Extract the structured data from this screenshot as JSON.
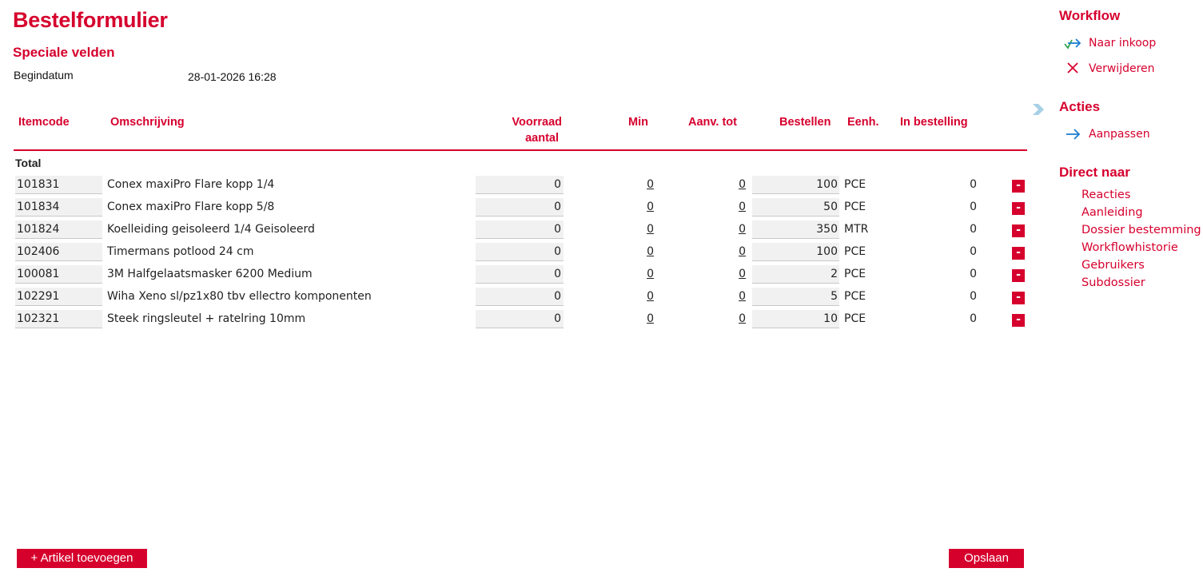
{
  "page": {
    "title": "Bestelformulier",
    "special_fields_title": "Speciale velden",
    "begindatum_label": "Begindatum",
    "begindatum_value": "28-01-2026 16:28",
    "total_label": "Total"
  },
  "table": {
    "columns": {
      "itemcode": "Itemcode",
      "omschrijving": "Omschrijving",
      "voorraad_line1": "Voorraad",
      "voorraad_line2": "aantal",
      "min": "Min",
      "aanv_tot": "Aanv. tot",
      "bestellen": "Bestellen",
      "eenh": "Eenh.",
      "in_bestelling": "In bestelling"
    },
    "rows": [
      {
        "code": "101831",
        "desc": "Conex maxiPro Flare kopp 1/4",
        "stock": "0",
        "min": "0",
        "aanv": "0",
        "order": "100",
        "unit": "PCE",
        "in_order": "0",
        "delete": "-"
      },
      {
        "code": "101834",
        "desc": "Conex maxiPro Flare kopp 5/8",
        "stock": "0",
        "min": "0",
        "aanv": "0",
        "order": "50",
        "unit": "PCE",
        "in_order": "0",
        "delete": "-"
      },
      {
        "code": "101824",
        "desc": "Koelleiding geisoleerd 1/4 Geisoleerd",
        "stock": "0",
        "min": "0",
        "aanv": "0",
        "order": "350",
        "unit": "MTR",
        "in_order": "0",
        "delete": "-"
      },
      {
        "code": "102406",
        "desc": "Timermans potlood 24 cm",
        "stock": "0",
        "min": "0",
        "aanv": "0",
        "order": "100",
        "unit": "PCE",
        "in_order": "0",
        "delete": "-"
      },
      {
        "code": "100081",
        "desc": "3M Halfgelaatsmasker 6200 Medium",
        "stock": "0",
        "min": "0",
        "aanv": "0",
        "order": "2",
        "unit": "PCE",
        "in_order": "0",
        "delete": "-"
      },
      {
        "code": "102291",
        "desc": "Wiha Xeno sl/pz1x80 tbv ellectro komponenten",
        "stock": "0",
        "min": "0",
        "aanv": "0",
        "order": "5",
        "unit": "PCE",
        "in_order": "0",
        "delete": "-"
      },
      {
        "code": "102321",
        "desc": "Steek ringsleutel + ratelring 10mm",
        "stock": "0",
        "min": "0",
        "aanv": "0",
        "order": "10",
        "unit": "PCE",
        "in_order": "0",
        "delete": "-"
      }
    ]
  },
  "buttons": {
    "add_article": "+ Artikel toevoegen",
    "save": "Opslaan"
  },
  "sidebar": {
    "workflow_title": "Workflow",
    "workflow_actions": [
      {
        "label": "Naar inkoop",
        "icon": "forward-arrow-check-icon"
      },
      {
        "label": "Verwijderen",
        "icon": "close-icon"
      }
    ],
    "actions_title": "Acties",
    "actions": [
      {
        "label": "Aanpassen",
        "icon": "arrow-right-icon"
      }
    ],
    "direct_title": "Direct naar",
    "direct_links": [
      "Reacties",
      "Aanleiding",
      "Dossier bestemming",
      "Workflowhistorie",
      "Gebruikers",
      "Subdossier"
    ]
  },
  "colors": {
    "accent": "#d6002d",
    "input_bg": "#f1f1f1",
    "icon_blue": "#1e7fd0",
    "icon_green": "#2fa44f"
  }
}
